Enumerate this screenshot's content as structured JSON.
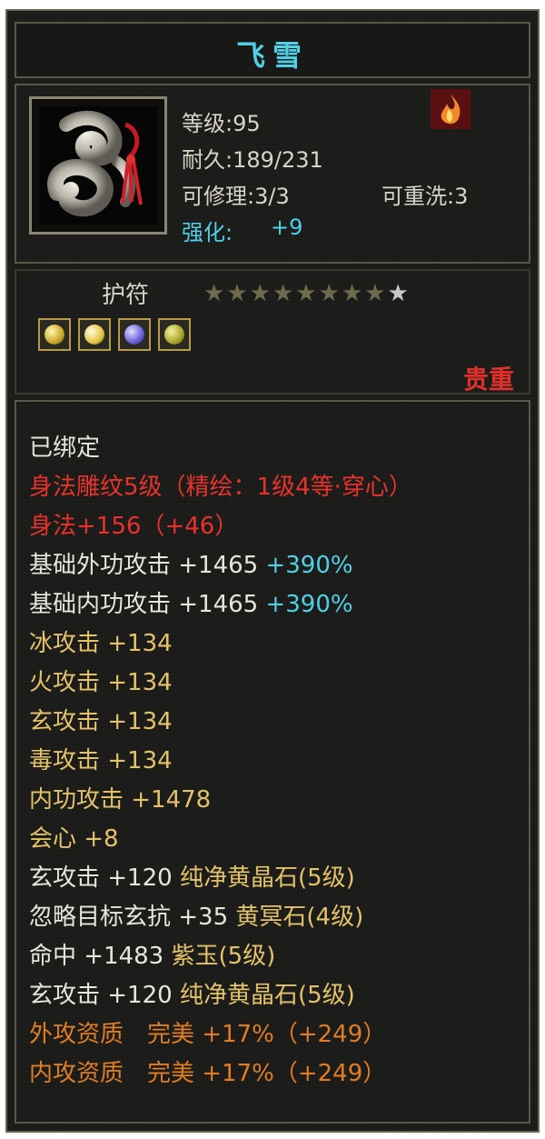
{
  "title": "飞雪",
  "colors": {
    "accent": "#4fd0e6",
    "red": "#e8322c",
    "gold": "#e4c26a",
    "orange": "#e07d25"
  },
  "item": {
    "icon": "white-jade-pendant-icon",
    "level": "等级:95",
    "durability": "耐久:189/231",
    "repair": "可修理:3/3",
    "rewash": "可重洗:3",
    "enhance_label": "强化:",
    "enhance_value": "+9",
    "badge_icon": "flame-badge-icon"
  },
  "charm": {
    "label": "护符",
    "stars_total": 9,
    "stars_lit": 1,
    "gems": [
      "yellow-gem-icon",
      "yellow-gem-icon",
      "purple-gem-icon",
      "yellow-gem-icon"
    ],
    "rarity": "贵重"
  },
  "props": {
    "bound": "已绑定",
    "engrave": "身法雕纹5级（精绘：1级4等·穿心）",
    "agility": "身法+156（+46）",
    "base_ext_label": "基础外功攻击 +1465",
    "base_ext_pct": "+390%",
    "base_int_label": "基础内功攻击 +1465",
    "base_int_pct": "+390%",
    "ice": "冰攻击 +134",
    "fire": "火攻击 +134",
    "xuan": "玄攻击 +134",
    "poison": "毒攻击 +134",
    "int_atk": "内功攻击 +1478",
    "crit": "会心 +8",
    "gem1_stat": "玄攻击 +120",
    "gem1_name": "纯净黄晶石(5级)",
    "gem2_stat": "忽略目标玄抗 +35",
    "gem2_name": "黄冥石(4级)",
    "gem3_stat": "命中 +1483",
    "gem3_name": "紫玉(5级)",
    "gem4_stat": "玄攻击 +120",
    "gem4_name": "纯净黄晶石(5级)",
    "ext_quality": "外攻资质　完美 +17%（+249）",
    "int_quality": "内攻资质　完美 +17%（+249）"
  }
}
